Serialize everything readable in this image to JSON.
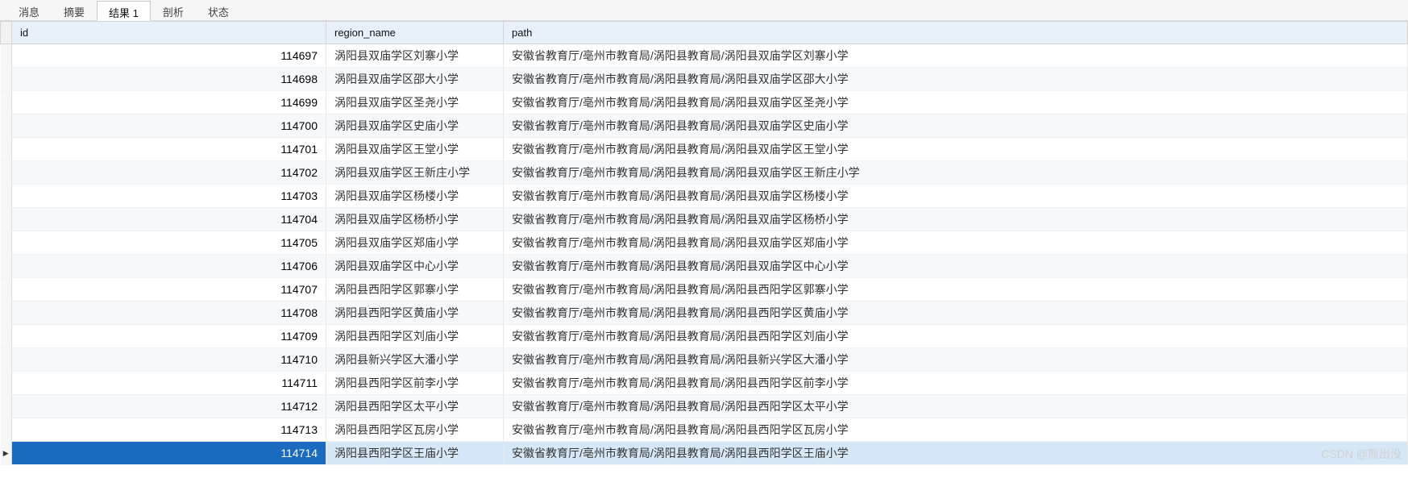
{
  "tabs": [
    {
      "label": "消息",
      "active": false
    },
    {
      "label": "摘要",
      "active": false
    },
    {
      "label": "结果 1",
      "active": true
    },
    {
      "label": "剖析",
      "active": false
    },
    {
      "label": "状态",
      "active": false
    }
  ],
  "columns": {
    "id": "id",
    "region_name": "region_name",
    "path": "path"
  },
  "rows": [
    {
      "id": "114697",
      "region_name": "涡阳县双庙学区刘寨小学",
      "path": "安徽省教育厅/亳州市教育局/涡阳县教育局/涡阳县双庙学区刘寨小学",
      "selected": false
    },
    {
      "id": "114698",
      "region_name": "涡阳县双庙学区邵大小学",
      "path": "安徽省教育厅/亳州市教育局/涡阳县教育局/涡阳县双庙学区邵大小学",
      "selected": false
    },
    {
      "id": "114699",
      "region_name": "涡阳县双庙学区圣尧小学",
      "path": "安徽省教育厅/亳州市教育局/涡阳县教育局/涡阳县双庙学区圣尧小学",
      "selected": false
    },
    {
      "id": "114700",
      "region_name": "涡阳县双庙学区史庙小学",
      "path": "安徽省教育厅/亳州市教育局/涡阳县教育局/涡阳县双庙学区史庙小学",
      "selected": false
    },
    {
      "id": "114701",
      "region_name": "涡阳县双庙学区王堂小学",
      "path": "安徽省教育厅/亳州市教育局/涡阳县教育局/涡阳县双庙学区王堂小学",
      "selected": false
    },
    {
      "id": "114702",
      "region_name": "涡阳县双庙学区王新庄小学",
      "path": "安徽省教育厅/亳州市教育局/涡阳县教育局/涡阳县双庙学区王新庄小学",
      "selected": false
    },
    {
      "id": "114703",
      "region_name": "涡阳县双庙学区杨楼小学",
      "path": "安徽省教育厅/亳州市教育局/涡阳县教育局/涡阳县双庙学区杨楼小学",
      "selected": false
    },
    {
      "id": "114704",
      "region_name": "涡阳县双庙学区杨桥小学",
      "path": "安徽省教育厅/亳州市教育局/涡阳县教育局/涡阳县双庙学区杨桥小学",
      "selected": false
    },
    {
      "id": "114705",
      "region_name": "涡阳县双庙学区郑庙小学",
      "path": "安徽省教育厅/亳州市教育局/涡阳县教育局/涡阳县双庙学区郑庙小学",
      "selected": false
    },
    {
      "id": "114706",
      "region_name": "涡阳县双庙学区中心小学",
      "path": "安徽省教育厅/亳州市教育局/涡阳县教育局/涡阳县双庙学区中心小学",
      "selected": false
    },
    {
      "id": "114707",
      "region_name": "涡阳县西阳学区郭寨小学",
      "path": "安徽省教育厅/亳州市教育局/涡阳县教育局/涡阳县西阳学区郭寨小学",
      "selected": false
    },
    {
      "id": "114708",
      "region_name": "涡阳县西阳学区黄庙小学",
      "path": "安徽省教育厅/亳州市教育局/涡阳县教育局/涡阳县西阳学区黄庙小学",
      "selected": false
    },
    {
      "id": "114709",
      "region_name": "涡阳县西阳学区刘庙小学",
      "path": "安徽省教育厅/亳州市教育局/涡阳县教育局/涡阳县西阳学区刘庙小学",
      "selected": false
    },
    {
      "id": "114710",
      "region_name": "涡阳县新兴学区大潘小学",
      "path": "安徽省教育厅/亳州市教育局/涡阳县教育局/涡阳县新兴学区大潘小学",
      "selected": false
    },
    {
      "id": "114711",
      "region_name": "涡阳县西阳学区前李小学",
      "path": "安徽省教育厅/亳州市教育局/涡阳县教育局/涡阳县西阳学区前李小学",
      "selected": false
    },
    {
      "id": "114712",
      "region_name": "涡阳县西阳学区太平小学",
      "path": "安徽省教育厅/亳州市教育局/涡阳县教育局/涡阳县西阳学区太平小学",
      "selected": false
    },
    {
      "id": "114713",
      "region_name": "涡阳县西阳学区瓦房小学",
      "path": "安徽省教育厅/亳州市教育局/涡阳县教育局/涡阳县西阳学区瓦房小学",
      "selected": false
    },
    {
      "id": "114714",
      "region_name": "涡阳县西阳学区王庙小学",
      "path": "安徽省教育厅/亳州市教育局/涡阳县教育局/涡阳县西阳学区王庙小学",
      "selected": true
    }
  ],
  "watermark": "CSDN @熊出没"
}
